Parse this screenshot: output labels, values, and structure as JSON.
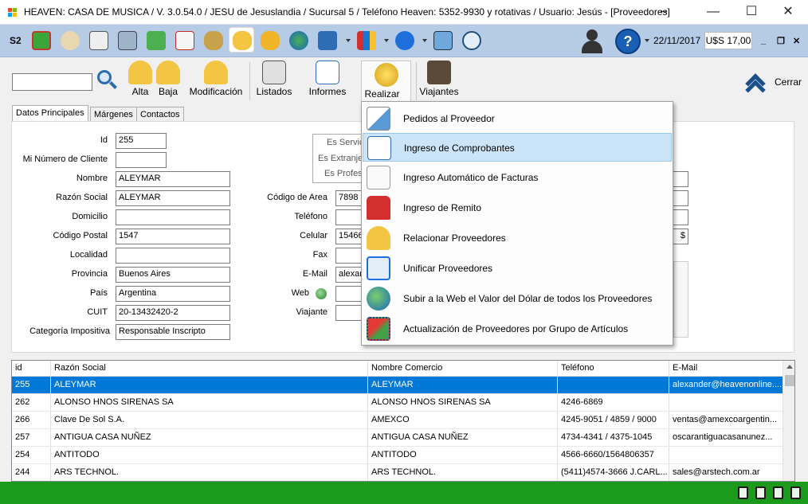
{
  "window": {
    "title": "HEAVEN: CASA DE MUSICA / V. 3.0.54.0 / JESU de Jesuslandia / Sucursal 5 / Teléfono Heaven: 5352-9930 y rotativas / Usuario: Jesús - [Proveedores]",
    "minimize": "—",
    "maximize": "☐",
    "close": "✕",
    "resize_glyph": "↔"
  },
  "iconbar": {
    "label": "S2",
    "date": "22/11/2017",
    "usd": "U$S 17,00",
    "help": "?",
    "mdi_minimize": "_",
    "mdi_restore": "❐",
    "mdi_close": "✕"
  },
  "toolbar": {
    "search_value": "",
    "buttons": {
      "alta": "Alta",
      "baja": "Baja",
      "modificacion": "Modificación",
      "listados": "Listados",
      "informes": "Informes",
      "realizar": "Realizar",
      "viajantes": "Viajantes"
    },
    "cerrar": "Cerrar"
  },
  "tabs": [
    "Datos Principales",
    "Márgenes",
    "Contactos"
  ],
  "form": {
    "id_label": "Id",
    "id_value": "255",
    "numcliente_label": "Mi Número de Cliente",
    "numcliente_value": "",
    "nombre_label": "Nombre",
    "nombre_value": "ALEYMAR",
    "razon_label": "Razón Social",
    "razon_value": "ALEYMAR",
    "domicilio_label": "Domicilio",
    "domicilio_value": "",
    "cp_label": "Código Postal",
    "cp_value": "1547",
    "localidad_label": "Localidad",
    "localidad_value": "",
    "provincia_label": "Provincia",
    "provincia_value": "Buenos Aires",
    "pais_label": "País",
    "pais_value": "Argentina",
    "cuit_label": "CUIT",
    "cuit_value": "20-13432420-2",
    "categoria_label": "Categoría Impositiva",
    "categoria_value": "Responsable Inscripto",
    "codarea_label": "Código de Area",
    "codarea_value": "7898",
    "telefono_label": "Teléfono",
    "telefono_value": "",
    "celular_label": "Celular",
    "celular_value": "15466",
    "fax_label": "Fax",
    "fax_value": "",
    "email_label": "E-Mail",
    "email_value": "alexan",
    "web_label": "Web",
    "web_value": "",
    "viajante_label": "Viajante",
    "viajante_value": "",
    "es_servicio": "Es Servic",
    "es_extranjero": "Es Extranjer",
    "es_profesional": "Es Profes",
    "currency_suffix": "$"
  },
  "grid": {
    "columns": [
      "id",
      "Razón Social",
      "Nombre Comercio",
      "Teléfono",
      "E-Mail"
    ],
    "rows": [
      [
        "255",
        "ALEYMAR",
        "ALEYMAR",
        "",
        "alexander@heavenonline...."
      ],
      [
        "262",
        "ALONSO HNOS SIRENAS SA",
        "ALONSO HNOS SIRENAS SA",
        "4246-6869",
        ""
      ],
      [
        "266",
        "Clave De Sol S.A.",
        "AMEXCO",
        "4245-9051 / 4859 / 9000",
        "ventas@amexcoargentin..."
      ],
      [
        "257",
        "ANTIGUA CASA NUÑEZ",
        "ANTIGUA CASA NUÑEZ",
        "4734-4341 / 4375-1045",
        "oscarantiguacasanunez..."
      ],
      [
        "254",
        "ANTITODO",
        "ANTITODO",
        "4566-6660/1564806357",
        ""
      ],
      [
        "244",
        "ARS TECHNOL.",
        "ARS TECHNOL.",
        "(5411)4574-3666 J.CARL...",
        "sales@arstech.com.ar"
      ]
    ]
  },
  "menu": {
    "items": [
      "Pedidos al Proveedor",
      "Ingreso de Comprobantes",
      "Ingreso Automático de Facturas",
      "Ingreso de Remito",
      "Relacionar Proveedores",
      "Unificar Proveedores",
      "Subir a la Web el Valor del Dólar de todos los Proveedores",
      "Actualización de Proveedores por Grupo de Artículos"
    ],
    "highlighted_index": 1
  },
  "colors": {
    "selection": "#0078d7",
    "statusbar": "#1b9a1b",
    "iconbar": "#b5cbe6",
    "menu_highlight": "#cce4f7"
  }
}
